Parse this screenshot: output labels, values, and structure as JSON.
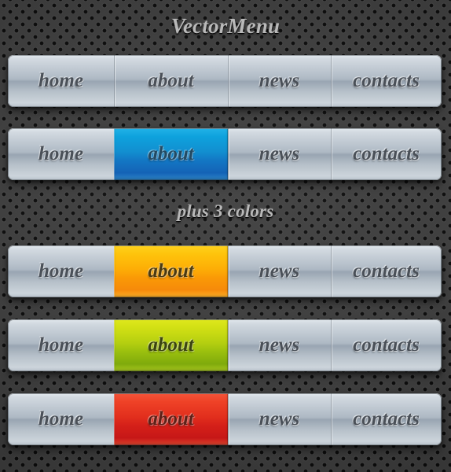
{
  "title": "VectorMenu",
  "subtitle": "plus 3 colors",
  "labels": {
    "home": "home",
    "about": "about",
    "news": "news",
    "contacts": "contacts"
  },
  "colors": {
    "background_plate": "#3a3a3a",
    "perforation_hole": "#0b0b0b",
    "bar_top": "#e4eaef",
    "bar_mid": "#99a5b2",
    "bar_bottom": "#ccd4db",
    "text": "#4a5058",
    "heading_text": "#b9b9b9",
    "active_blue": "#0ea2dd",
    "active_orange": "#fec40c",
    "active_green": "#d2e014",
    "active_red": "#ef4227"
  },
  "bars": [
    {
      "id": "bar-default",
      "accent": "none",
      "items": [
        {
          "label": "home",
          "active": false
        },
        {
          "label": "about",
          "active": false
        },
        {
          "label": "news",
          "active": false
        },
        {
          "label": "contacts",
          "active": false
        }
      ]
    },
    {
      "id": "bar-blue",
      "accent": "blue",
      "items": [
        {
          "label": "home",
          "active": false
        },
        {
          "label": "about",
          "active": true
        },
        {
          "label": "news",
          "active": false
        },
        {
          "label": "contacts",
          "active": false
        }
      ]
    },
    {
      "id": "bar-orange",
      "accent": "orange",
      "items": [
        {
          "label": "home",
          "active": false
        },
        {
          "label": "about",
          "active": true
        },
        {
          "label": "news",
          "active": false
        },
        {
          "label": "contacts",
          "active": false
        }
      ]
    },
    {
      "id": "bar-green",
      "accent": "green",
      "items": [
        {
          "label": "home",
          "active": false
        },
        {
          "label": "about",
          "active": true
        },
        {
          "label": "news",
          "active": false
        },
        {
          "label": "contacts",
          "active": false
        }
      ]
    },
    {
      "id": "bar-red",
      "accent": "red",
      "items": [
        {
          "label": "home",
          "active": false
        },
        {
          "label": "about",
          "active": true
        },
        {
          "label": "news",
          "active": false
        },
        {
          "label": "contacts",
          "active": false
        }
      ]
    }
  ]
}
